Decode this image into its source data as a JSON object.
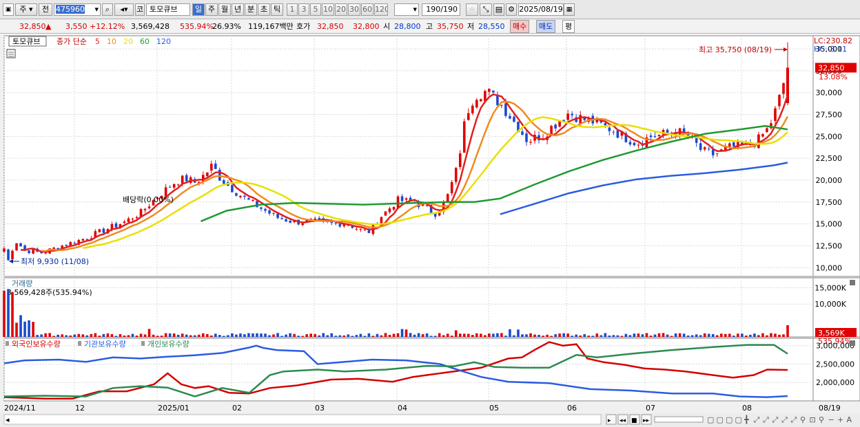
{
  "toolbar": {
    "market": "주",
    "mode": "전",
    "code": "475960",
    "name_prefix": "코",
    "name": "토모큐브",
    "periods": [
      "일",
      "주",
      "월",
      "년",
      "분",
      "초",
      "틱"
    ],
    "active_period": "일",
    "nums": [
      "1",
      "3",
      "5",
      "10",
      "20",
      "30",
      "60",
      "120"
    ],
    "count": "190/190",
    "date": "2025/08/19"
  },
  "quote": {
    "price": "32,850",
    "arrow": "▲",
    "change": "3,550",
    "pct": "+12.12%",
    "volume": "3,569,428",
    "vol_ratio": "535.94%",
    "turnover": "26.93%",
    "amount": "119,167백만",
    "hoga_label": "호가",
    "hoga1": "32,850",
    "hoga2": "32,800",
    "open_label": "시",
    "open": "28,800",
    "high_label": "고",
    "high": "35,750",
    "low_label": "저",
    "low": "28,550",
    "buy": "매수",
    "sell": "매도",
    "avg": "평"
  },
  "legend": {
    "name": "토모큐브",
    "ma_label": "종가 단순",
    "ma": [
      "5",
      "10",
      "20",
      "60",
      "120"
    ],
    "ma_colors": [
      "#e02020",
      "#f08a20",
      "#e8e000",
      "#1f9a30",
      "#2a5ce0"
    ]
  },
  "annotations": {
    "high": "최고 35,750 (08/19)",
    "low": "최저 9,930 (11/08)",
    "div": "배당락(0.00%)",
    "lc": "LC:230.82",
    "hc": "HC:-8.11"
  },
  "price_tag": {
    "value": "32,850",
    "pct": "13.08%"
  },
  "vol_panel": {
    "title": "거래량",
    "info": "3,569,428주(535.94%)",
    "tag": "3,569K",
    "tag_pct": "535.94%"
  },
  "hold_panel": {
    "series": [
      "외국인보유수량",
      "기관보유수량",
      "개인보유수량"
    ],
    "colors": [
      "#d40000",
      "#2a5ce0",
      "#2a8a50"
    ]
  },
  "x_labels": [
    "2024/11",
    "12",
    "2025/01",
    "02",
    "03",
    "04",
    "05",
    "06",
    "07",
    "08",
    "08/19"
  ],
  "chart_data": [
    {
      "type": "candlestick",
      "title": "토모큐브",
      "y_ticks": [
        "35,000",
        "32,500",
        "30,000",
        "27,500",
        "25,000",
        "22,500",
        "20,000",
        "17,500",
        "15,000",
        "12,500",
        "10,000"
      ],
      "ylim": [
        9000,
        36500
      ],
      "n_bars": 190,
      "close_path": [
        [
          0,
          12200
        ],
        [
          3,
          10500
        ],
        [
          6,
          13200
        ],
        [
          12,
          12000
        ],
        [
          22,
          11700
        ],
        [
          32,
          12400
        ],
        [
          45,
          13200
        ],
        [
          55,
          14000
        ],
        [
          70,
          15200
        ],
        [
          80,
          16300
        ],
        [
          90,
          18200
        ],
        [
          100,
          19800
        ],
        [
          106,
          20200
        ],
        [
          112,
          19700
        ],
        [
          118,
          20800
        ],
        [
          122,
          21800
        ],
        [
          125,
          20500
        ],
        [
          132,
          19200
        ],
        [
          140,
          18000
        ],
        [
          150,
          16800
        ],
        [
          160,
          15700
        ],
        [
          170,
          15200
        ],
        [
          180,
          15300
        ],
        [
          190,
          15000
        ],
        [
          200,
          15100
        ],
        [
          208,
          14300
        ],
        [
          214,
          14100
        ],
        [
          220,
          15800
        ],
        [
          230,
          17700
        ],
        [
          240,
          17500
        ],
        [
          252,
          16200
        ],
        [
          258,
          17500
        ],
        [
          265,
          21500
        ],
        [
          270,
          27500
        ],
        [
          275,
          29700
        ],
        [
          282,
          30200
        ],
        [
          290,
          28800
        ],
        [
          300,
          26200
        ],
        [
          306,
          24500
        ],
        [
          315,
          25200
        ],
        [
          322,
          26400
        ],
        [
          330,
          27700
        ],
        [
          338,
          27000
        ],
        [
          344,
          26700
        ],
        [
          350,
          26200
        ],
        [
          355,
          25800
        ],
        [
          362,
          25000
        ],
        [
          370,
          24200
        ],
        [
          378,
          25000
        ],
        [
          385,
          25200
        ],
        [
          392,
          25600
        ],
        [
          400,
          25100
        ],
        [
          408,
          23300
        ],
        [
          415,
          22900
        ],
        [
          425,
          23800
        ],
        [
          432,
          23800
        ],
        [
          440,
          24400
        ],
        [
          447,
          26000
        ],
        [
          452,
          28500
        ],
        [
          458,
          32850
        ]
      ],
      "ma_series": [
        {
          "name": "5",
          "color": "#e02020"
        },
        {
          "name": "10",
          "color": "#f08a20"
        },
        {
          "name": "20",
          "color": "#e8e000"
        },
        {
          "name": "60",
          "color": "#1f9a30",
          "values": [
            [
              115,
              15300
            ],
            [
              130,
              16500
            ],
            [
              150,
              17200
            ],
            [
              170,
              17400
            ],
            [
              190,
              17300
            ],
            [
              210,
              17200
            ],
            [
              240,
              17400
            ],
            [
              260,
              17500
            ],
            [
              275,
              17500
            ],
            [
              290,
              17900
            ],
            [
              310,
              19500
            ],
            [
              330,
              21000
            ],
            [
              350,
              22300
            ],
            [
              370,
              23400
            ],
            [
              390,
              24400
            ],
            [
              410,
              25300
            ],
            [
              430,
              25800
            ],
            [
              445,
              26200
            ],
            [
              458,
              25800
            ]
          ]
        },
        {
          "name": "120",
          "color": "#2a5ce0",
          "values": [
            [
              290,
              16100
            ],
            [
              310,
              17300
            ],
            [
              330,
              18500
            ],
            [
              350,
              19400
            ],
            [
              370,
              20100
            ],
            [
              390,
              20500
            ],
            [
              410,
              20800
            ],
            [
              430,
              21200
            ],
            [
              450,
              21700
            ],
            [
              458,
              22000
            ]
          ]
        }
      ]
    },
    {
      "type": "bar",
      "title": "거래량",
      "y_ticks": [
        "15,000K",
        "10,000K"
      ]
    },
    {
      "type": "line",
      "title": "보유수량",
      "y_ticks": [
        "3,000,000",
        "2,500,000",
        "2,000,000"
      ],
      "ylim": [
        1500000,
        3200000
      ],
      "series": [
        {
          "name": "외국인보유수량",
          "color": "#d40000",
          "values": [
            [
              0,
              1600000
            ],
            [
              30,
              1560000
            ],
            [
              50,
              1560000
            ],
            [
              70,
              1760000
            ],
            [
              90,
              1760000
            ],
            [
              110,
              1950000
            ],
            [
              120,
              2250000
            ],
            [
              130,
              1950000
            ],
            [
              140,
              1850000
            ],
            [
              150,
              1900000
            ],
            [
              165,
              1720000
            ],
            [
              180,
              1700000
            ],
            [
              195,
              1850000
            ],
            [
              215,
              1920000
            ],
            [
              240,
              2080000
            ],
            [
              260,
              2100000
            ],
            [
              285,
              2020000
            ],
            [
              300,
              2150000
            ],
            [
              330,
              2300000
            ],
            [
              350,
              2400000
            ],
            [
              370,
              2650000
            ],
            [
              380,
              2680000
            ],
            [
              390,
              2900000
            ],
            [
              400,
              3100000
            ],
            [
              410,
              3000000
            ],
            [
              420,
              3040000
            ],
            [
              428,
              2650000
            ],
            [
              440,
              2550000
            ],
            [
              455,
              2480000
            ],
            [
              470,
              2380000
            ],
            [
              485,
              2350000
            ],
            [
              500,
              2300000
            ],
            [
              520,
              2200000
            ],
            [
              535,
              2130000
            ],
            [
              550,
              2200000
            ],
            [
              560,
              2350000
            ],
            [
              575,
              2340000
            ]
          ]
        },
        {
          "name": "기관보유수량",
          "color": "#2a5ce0",
          "values": [
            [
              0,
              2520000
            ],
            [
              15,
              2600000
            ],
            [
              40,
              2620000
            ],
            [
              60,
              2560000
            ],
            [
              80,
              2680000
            ],
            [
              100,
              2650000
            ],
            [
              120,
              2700000
            ],
            [
              140,
              2740000
            ],
            [
              160,
              2800000
            ],
            [
              180,
              2950000
            ],
            [
              185,
              3000000
            ],
            [
              190,
              2940000
            ],
            [
              200,
              2880000
            ],
            [
              220,
              2850000
            ],
            [
              230,
              2500000
            ],
            [
              250,
              2560000
            ],
            [
              270,
              2620000
            ],
            [
              295,
              2600000
            ],
            [
              320,
              2500000
            ],
            [
              335,
              2320000
            ],
            [
              350,
              2150000
            ],
            [
              370,
              2020000
            ],
            [
              400,
              1980000
            ],
            [
              430,
              1820000
            ],
            [
              460,
              1780000
            ],
            [
              490,
              1700000
            ],
            [
              520,
              1700000
            ],
            [
              540,
              1620000
            ],
            [
              560,
              1600000
            ],
            [
              575,
              1630000
            ]
          ]
        },
        {
          "name": "개인보유수량",
          "color": "#2a8a50",
          "values": [
            [
              0,
              1620000
            ],
            [
              30,
              1640000
            ],
            [
              60,
              1620000
            ],
            [
              80,
              1850000
            ],
            [
              100,
              1900000
            ],
            [
              120,
              1860000
            ],
            [
              140,
              1620000
            ],
            [
              160,
              1850000
            ],
            [
              180,
              1720000
            ],
            [
              195,
              2200000
            ],
            [
              205,
              2300000
            ],
            [
              230,
              2350000
            ],
            [
              250,
              2300000
            ],
            [
              280,
              2350000
            ],
            [
              310,
              2450000
            ],
            [
              330,
              2440000
            ],
            [
              345,
              2550000
            ],
            [
              360,
              2420000
            ],
            [
              380,
              2400000
            ],
            [
              400,
              2400000
            ],
            [
              420,
              2750000
            ],
            [
              435,
              2680000
            ],
            [
              460,
              2780000
            ],
            [
              490,
              2880000
            ],
            [
              520,
              2960000
            ],
            [
              545,
              3020000
            ],
            [
              565,
              3020000
            ],
            [
              575,
              2780000
            ]
          ]
        }
      ]
    }
  ]
}
